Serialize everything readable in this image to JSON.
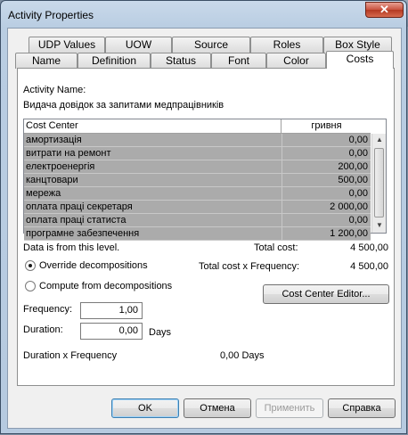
{
  "window": {
    "title": "Activity Properties",
    "close_glyph": "✕"
  },
  "tabs_row1": [
    "UDP Values",
    "UOW",
    "Source",
    "Roles",
    "Box Style"
  ],
  "tabs_row2": [
    "Name",
    "Definition",
    "Status",
    "Font",
    "Color",
    "Costs"
  ],
  "activity": {
    "name_label": "Activity Name:",
    "name_value": "Видача довідок за запитами  медпрацівників"
  },
  "cost_table": {
    "col_center": "Cost Center",
    "col_currency": "гривня",
    "rows": [
      {
        "name": "амортизація",
        "value": "0,00"
      },
      {
        "name": "витрати на ремонт",
        "value": "0,00"
      },
      {
        "name": "електроенергія",
        "value": "200,00"
      },
      {
        "name": "канцтовари",
        "value": "500,00"
      },
      {
        "name": "мережа",
        "value": "0,00"
      },
      {
        "name": "оплата праці секретаря",
        "value": "2 000,00"
      },
      {
        "name": "оплата праці статиста",
        "value": "0,00"
      },
      {
        "name": "програмне забезпечення",
        "value": "1 200,00"
      }
    ]
  },
  "summary": {
    "data_source": "Data is from this level.",
    "total_cost_label": "Total cost:",
    "total_cost_value": "4 500,00",
    "total_freq_label": "Total cost x Frequency:",
    "total_freq_value": "4 500,00"
  },
  "options": {
    "override": "Override decompositions",
    "compute": "Compute from decompositions",
    "selected": "override"
  },
  "editor_button": "Cost Center Editor...",
  "frequency": {
    "label": "Frequency:",
    "value": "1,00"
  },
  "duration": {
    "label": "Duration:",
    "value": "0,00",
    "unit": "Days"
  },
  "duration_freq": {
    "label": "Duration x Frequency",
    "value": "0,00 Days"
  },
  "buttons": {
    "ok": "OK",
    "cancel": "Отмена",
    "apply": "Применить",
    "help": "Справка"
  }
}
